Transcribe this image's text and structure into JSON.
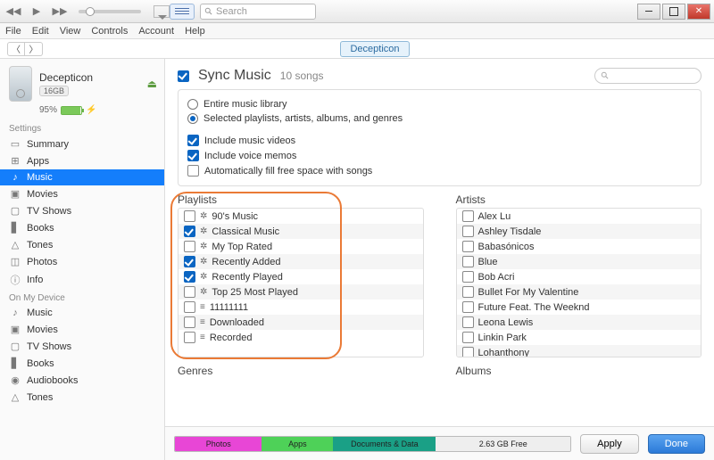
{
  "titlebar": {
    "search_placeholder": "Search"
  },
  "menubar": [
    "File",
    "Edit",
    "View",
    "Controls",
    "Account",
    "Help"
  ],
  "breadcrumb": "Decepticon",
  "device": {
    "name": "Decepticon",
    "capacity": "16GB",
    "battery_pct": "95%"
  },
  "sidebar": {
    "settings_label": "Settings",
    "settings": [
      {
        "label": "Summary",
        "icon": "▭"
      },
      {
        "label": "Apps",
        "icon": "⊞"
      },
      {
        "label": "Music",
        "icon": "♪"
      },
      {
        "label": "Movies",
        "icon": "▣"
      },
      {
        "label": "TV Shows",
        "icon": "▢"
      },
      {
        "label": "Books",
        "icon": "▋"
      },
      {
        "label": "Tones",
        "icon": "△"
      },
      {
        "label": "Photos",
        "icon": "◫"
      },
      {
        "label": "Info",
        "icon": "ⓘ"
      }
    ],
    "ondevice_label": "On My Device",
    "ondevice": [
      {
        "label": "Music",
        "icon": "♪"
      },
      {
        "label": "Movies",
        "icon": "▣"
      },
      {
        "label": "TV Shows",
        "icon": "▢"
      },
      {
        "label": "Books",
        "icon": "▋"
      },
      {
        "label": "Audiobooks",
        "icon": "◉"
      },
      {
        "label": "Tones",
        "icon": "△"
      }
    ]
  },
  "main": {
    "sync_title": "Sync Music",
    "sync_count": "10 songs",
    "opt_entire": "Entire music library",
    "opt_selected": "Selected playlists, artists, albums, and genres",
    "opt_videos": "Include music videos",
    "opt_memos": "Include voice memos",
    "opt_fill": "Automatically fill free space with songs",
    "hdr_playlists": "Playlists",
    "hdr_artists": "Artists",
    "hdr_genres": "Genres",
    "hdr_albums": "Albums"
  },
  "playlists": [
    {
      "name": "90's Music",
      "checked": false,
      "kind": "smart"
    },
    {
      "name": "Classical Music",
      "checked": true,
      "kind": "smart"
    },
    {
      "name": "My Top Rated",
      "checked": false,
      "kind": "smart"
    },
    {
      "name": "Recently Added",
      "checked": true,
      "kind": "smart"
    },
    {
      "name": "Recently Played",
      "checked": true,
      "kind": "smart"
    },
    {
      "name": "Top 25 Most Played",
      "checked": false,
      "kind": "smart"
    },
    {
      "name": "11111111",
      "checked": false,
      "kind": "plain"
    },
    {
      "name": "Downloaded",
      "checked": false,
      "kind": "plain"
    },
    {
      "name": "Recorded",
      "checked": false,
      "kind": "plain"
    }
  ],
  "artists": [
    "Alex Lu",
    "Ashley Tisdale",
    "Babasónicos",
    "Blue",
    "Bob Acri",
    "Bullet For My Valentine",
    "Future Feat. The Weeknd",
    "Leona Lewis",
    "Linkin Park",
    "Lohanthony"
  ],
  "capacity_bar": [
    {
      "label": "Photos",
      "color": "#e846d6",
      "width": "22%"
    },
    {
      "label": "Apps",
      "color": "#4ed158",
      "width": "18%"
    },
    {
      "label": "Documents & Data",
      "color": "#1aa086",
      "width": "26%"
    },
    {
      "label": "2.63 GB Free",
      "color": "#eeeeee",
      "width": "34%"
    }
  ],
  "footer": {
    "apply": "Apply",
    "done": "Done"
  }
}
